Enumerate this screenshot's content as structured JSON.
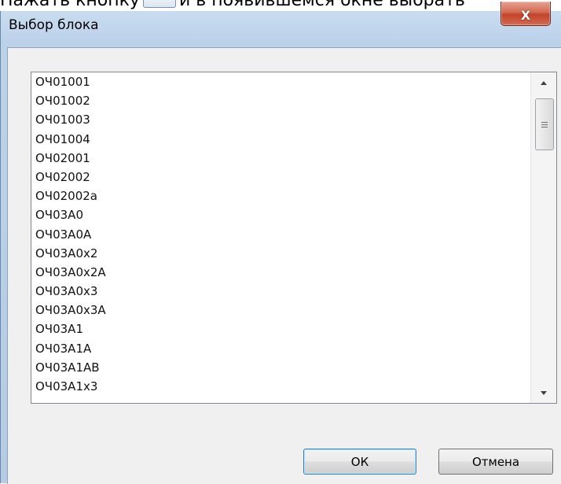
{
  "background": {
    "text_before": "Нажать кнопку",
    "text_after": "и в появившемся окне выбрать"
  },
  "window": {
    "title": "Выбор блока",
    "close_label": "X"
  },
  "list": {
    "items": [
      "ОЧ01001",
      "ОЧ01002",
      "ОЧ01003",
      "ОЧ01004",
      "ОЧ02001",
      "ОЧ02002",
      "ОЧ02002а",
      "ОЧ03А0",
      "ОЧ03А0А",
      "ОЧ03А0х2",
      "ОЧ03А0х2А",
      "ОЧ03А0х3",
      "ОЧ03А0х3А",
      "ОЧ03А1",
      "ОЧ03А1А",
      "ОЧ03А1АВ",
      "ОЧ03А1х3"
    ]
  },
  "scrollbar": {
    "up_icon": "chevron-up-icon",
    "down_icon": "chevron-down-icon",
    "position_fraction": 0.0
  },
  "buttons": {
    "ok_label": "ОК",
    "cancel_label": "Отмена"
  },
  "colors": {
    "frame": "#bcd2ea",
    "close_button": "#c2432a",
    "client": "#f0f0f0",
    "default_button_border": "#3c7fb1"
  }
}
